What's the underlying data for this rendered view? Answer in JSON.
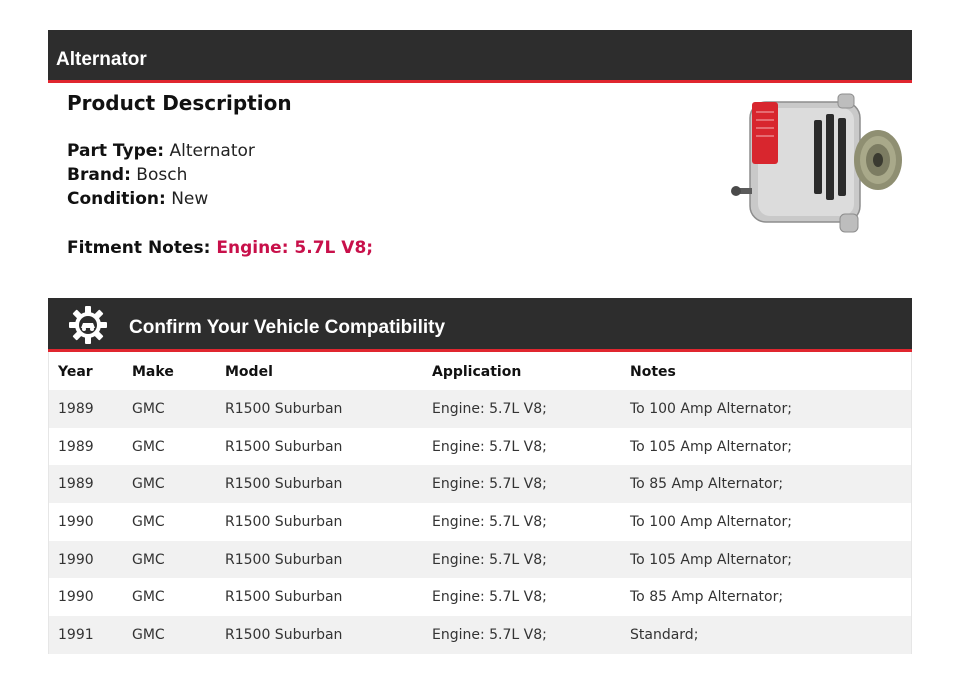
{
  "header": {
    "title": "Alternator"
  },
  "description": {
    "title": "Product Description",
    "part_type_label": "Part Type:",
    "part_type": "Alternator",
    "brand_label": "Brand:",
    "brand": "Bosch",
    "condition_label": "Condition:",
    "condition": "New",
    "fitment_label": "Fitment Notes:",
    "fitment": "Engine: 5.7L V8;",
    "accent_color": "#c8104a"
  },
  "compat": {
    "title": "Confirm Your Vehicle Compatibility",
    "columns": [
      "Year",
      "Make",
      "Model",
      "Application",
      "Notes"
    ],
    "rows": [
      [
        "1989",
        "GMC",
        "R1500 Suburban",
        "Engine: 5.7L V8;",
        "To 100 Amp Alternator;"
      ],
      [
        "1989",
        "GMC",
        "R1500 Suburban",
        "Engine: 5.7L V8;",
        "To 105 Amp Alternator;"
      ],
      [
        "1989",
        "GMC",
        "R1500 Suburban",
        "Engine: 5.7L V8;",
        "To 85 Amp Alternator;"
      ],
      [
        "1990",
        "GMC",
        "R1500 Suburban",
        "Engine: 5.7L V8;",
        "To 100 Amp Alternator;"
      ],
      [
        "1990",
        "GMC",
        "R1500 Suburban",
        "Engine: 5.7L V8;",
        "To 105 Amp Alternator;"
      ],
      [
        "1990",
        "GMC",
        "R1500 Suburban",
        "Engine: 5.7L V8;",
        "To 85 Amp Alternator;"
      ],
      [
        "1991",
        "GMC",
        "R1500 Suburban",
        "Engine: 5.7L V8;",
        "Standard;"
      ]
    ]
  },
  "colors": {
    "bar": "#2d2d2d",
    "bar_accent": "#e0262f"
  },
  "icons": {
    "compat_icon": "gear-car-icon",
    "product_image": "alternator-image"
  }
}
